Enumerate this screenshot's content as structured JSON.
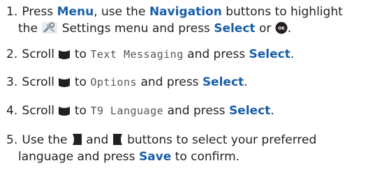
{
  "steps": [
    {
      "number": "1.",
      "press": "Press",
      "menu": "Menu",
      "use_the": ", use the",
      "navigation": "Navigation",
      "buttons_to_highlight": "buttons to highlight",
      "the": "the",
      "settings_menu": "Settings menu and press",
      "select": "Select",
      "or": "or",
      "end": "."
    },
    {
      "number": "2.",
      "scroll": "Scroll",
      "to": "to",
      "lcd": "Text Messaging",
      "and_press": "and press",
      "select": "Select",
      "end": "."
    },
    {
      "number": "3.",
      "scroll": "Scroll",
      "to": "to",
      "lcd": "Options",
      "and_press": "and press",
      "select": "Select",
      "end": "."
    },
    {
      "number": "4.",
      "scroll": "Scroll",
      "to": "to",
      "lcd": "T9 Language",
      "and_press": "and press",
      "select": "Select",
      "end": "."
    },
    {
      "number": "5.",
      "use_the": "Use the",
      "and": "and",
      "buttons_to_select": "buttons to select your preferred",
      "language_and_press": "language and press",
      "save": "Save",
      "to_confirm": "to confirm."
    }
  ],
  "icons": {
    "settings": "settings-wrench-icon",
    "ok": "ok-button-icon",
    "scroll_down": "scroll-down-key-icon",
    "left": "left-key-icon",
    "right": "right-key-icon"
  },
  "colors": {
    "keyword": "#1a5fa8",
    "text": "#231f20",
    "lcd": "#555555"
  }
}
